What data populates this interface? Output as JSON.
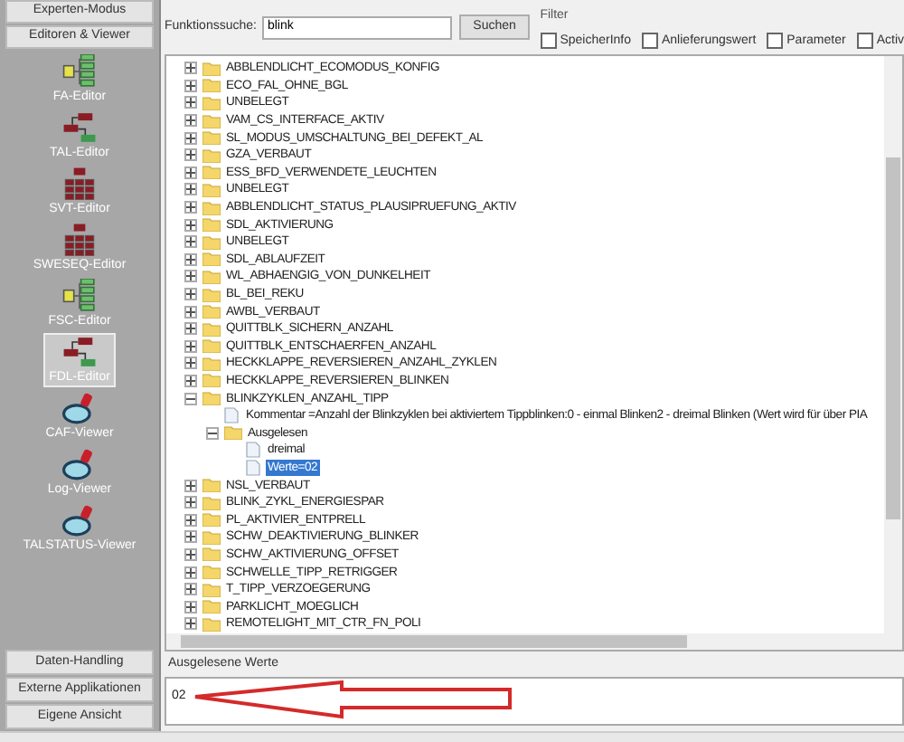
{
  "sidebar": {
    "top_buttons": [
      "Experten-Modus",
      "Editoren & Viewer"
    ],
    "tools": [
      {
        "label": "FA-Editor",
        "kind": "tree",
        "selected": false
      },
      {
        "label": "TAL-Editor",
        "kind": "flow",
        "selected": false
      },
      {
        "label": "SVT-Editor",
        "kind": "grid",
        "selected": false
      },
      {
        "label": "SWESEQ-Editor",
        "kind": "grid",
        "selected": false
      },
      {
        "label": "FSC-Editor",
        "kind": "tree",
        "selected": false
      },
      {
        "label": "FDL-Editor",
        "kind": "flow",
        "selected": true
      },
      {
        "label": "CAF-Viewer",
        "kind": "viewer",
        "selected": false
      },
      {
        "label": "Log-Viewer",
        "kind": "viewer",
        "selected": false
      },
      {
        "label": "TALSTATUS-Viewer",
        "kind": "viewer",
        "selected": false
      }
    ],
    "bottom_buttons": [
      "Daten-Handling",
      "Externe Applikationen",
      "Eigene Ansicht"
    ]
  },
  "search": {
    "label": "Funktionssuche:",
    "value": "blink",
    "button": "Suchen"
  },
  "filter": {
    "title": "Filter",
    "options": [
      {
        "label": "SpeicherInfo",
        "checked": false
      },
      {
        "label": "Anlieferungswert",
        "checked": false
      },
      {
        "label": "Parameter",
        "checked": false
      },
      {
        "label": "Activ",
        "checked": false
      }
    ]
  },
  "tree": [
    {
      "label": "ABBLENDLICHT_ECOMODUS_KONFIG",
      "kind": "folder",
      "expanded": false
    },
    {
      "label": "ECO_FAL_OHNE_BGL",
      "kind": "folder",
      "expanded": false
    },
    {
      "label": "UNBELEGT",
      "kind": "folder",
      "expanded": false
    },
    {
      "label": "VAM_CS_INTERFACE_AKTIV",
      "kind": "folder",
      "expanded": false
    },
    {
      "label": "SL_MODUS_UMSCHALTUNG_BEI_DEFEKT_AL",
      "kind": "folder",
      "expanded": false
    },
    {
      "label": "GZA_VERBAUT",
      "kind": "folder",
      "expanded": false
    },
    {
      "label": "ESS_BFD_VERWENDETE_LEUCHTEN",
      "kind": "folder",
      "expanded": false
    },
    {
      "label": "UNBELEGT",
      "kind": "folder",
      "expanded": false
    },
    {
      "label": "ABBLENDLICHT_STATUS_PLAUSIPRUEFUNG_AKTIV",
      "kind": "folder",
      "expanded": false
    },
    {
      "label": "SDL_AKTIVIERUNG",
      "kind": "folder",
      "expanded": false
    },
    {
      "label": "UNBELEGT",
      "kind": "folder",
      "expanded": false
    },
    {
      "label": "SDL_ABLAUFZEIT",
      "kind": "folder",
      "expanded": false
    },
    {
      "label": "WL_ABHAENGIG_VON_DUNKELHEIT",
      "kind": "folder",
      "expanded": false
    },
    {
      "label": "BL_BEI_REKU",
      "kind": "folder",
      "expanded": false
    },
    {
      "label": "AWBL_VERBAUT",
      "kind": "folder",
      "expanded": false
    },
    {
      "label": "QUITTBLK_SICHERN_ANZAHL",
      "kind": "folder",
      "expanded": false
    },
    {
      "label": "QUITTBLK_ENTSCHAERFEN_ANZAHL",
      "kind": "folder",
      "expanded": false
    },
    {
      "label": "HECKKLAPPE_REVERSIEREN_ANZAHL_ZYKLEN",
      "kind": "folder",
      "expanded": false
    },
    {
      "label": "HECKKLAPPE_REVERSIEREN_BLINKEN",
      "kind": "folder",
      "expanded": false
    },
    {
      "label": "BLINKZYKLEN_ANZAHL_TIPP",
      "kind": "folder",
      "expanded": true,
      "children": [
        {
          "label": "Kommentar =Anzahl der Blinkzyklen bei aktiviertem Tippblinken:0 - einmal Blinken2 - dreimal Blinken (Wert wird für über PIA",
          "kind": "file",
          "selected": false
        },
        {
          "label": "Ausgelesen",
          "kind": "folder",
          "expanded": true,
          "children": [
            {
              "label": "dreimal",
              "kind": "file",
              "selected": false
            },
            {
              "label": "Werte=02",
              "kind": "file",
              "selected": true
            }
          ]
        }
      ]
    },
    {
      "label": "NSL_VERBAUT",
      "kind": "folder",
      "expanded": false
    },
    {
      "label": "BLINK_ZYKL_ENERGIESPAR",
      "kind": "folder",
      "expanded": false
    },
    {
      "label": "PL_AKTIVIER_ENTPRELL",
      "kind": "folder",
      "expanded": false
    },
    {
      "label": "SCHW_DEAKTIVIERUNG_BLINKER",
      "kind": "folder",
      "expanded": false
    },
    {
      "label": "SCHW_AKTIVIERUNG_OFFSET",
      "kind": "folder",
      "expanded": false
    },
    {
      "label": "SCHWELLE_TIPP_RETRIGGER",
      "kind": "folder",
      "expanded": false
    },
    {
      "label": "T_TIPP_VERZOEGERUNG",
      "kind": "folder",
      "expanded": false
    },
    {
      "label": "PARKLICHT_MOEGLICH",
      "kind": "folder",
      "expanded": false
    },
    {
      "label": "REMOTELIGHT_MIT_CTR_FN_POLI",
      "kind": "folder",
      "expanded": false
    }
  ],
  "output": {
    "title": "Ausgelesene Werte",
    "value": "02"
  }
}
